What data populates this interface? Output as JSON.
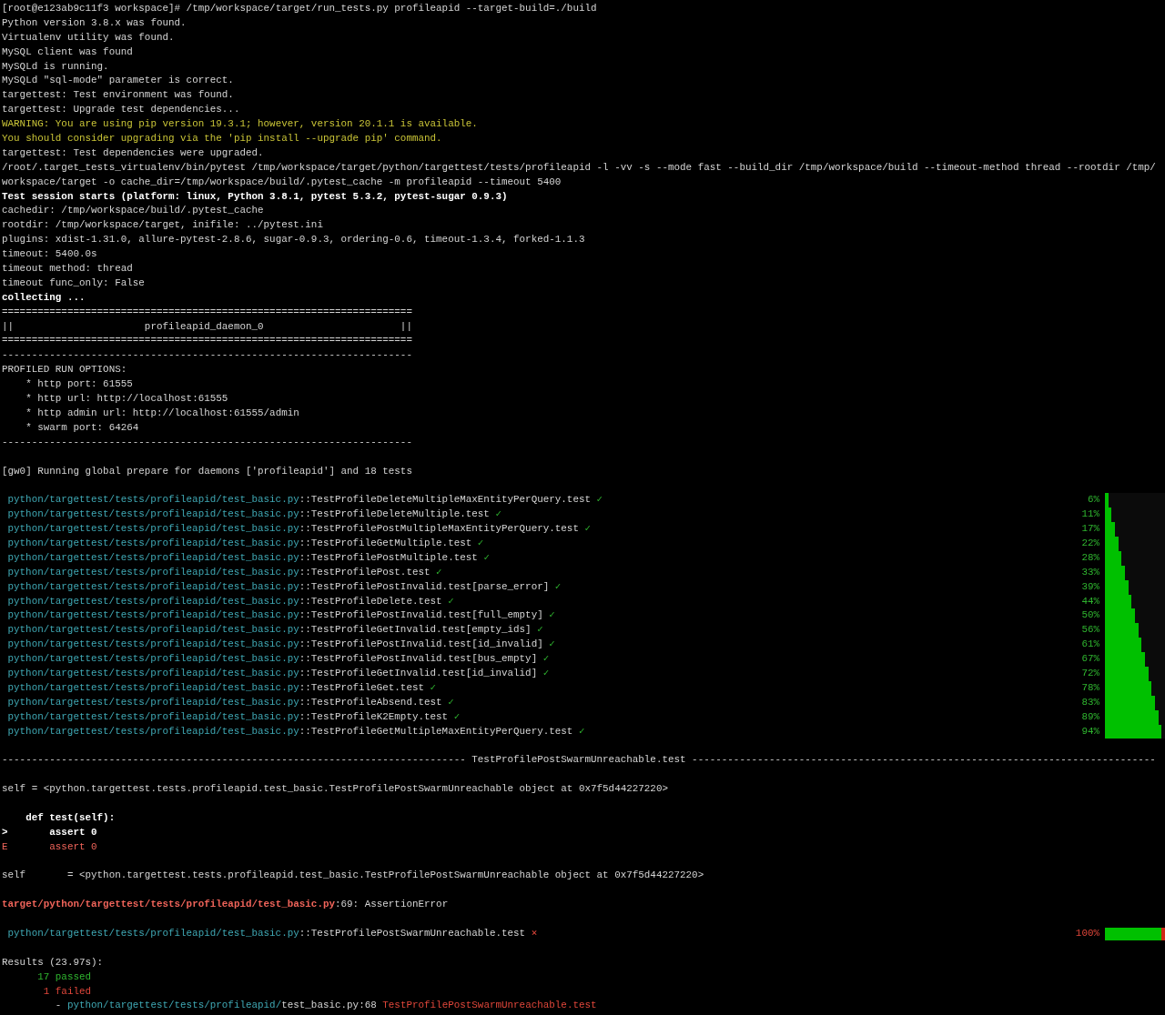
{
  "terminal": {
    "lines": [
      {
        "kind": "line",
        "segments": [
          {
            "text": "[root@e123ab9c11f3 workspace]# /tmp/workspace/target/run_tests.py profileapid --target-build=./build",
            "kind": "plain"
          }
        ]
      },
      {
        "kind": "line",
        "segments": [
          {
            "text": "Python version 3.8.x was found.",
            "kind": "plain"
          }
        ]
      },
      {
        "kind": "line",
        "segments": [
          {
            "text": "Virtualenv utility was found.",
            "kind": "plain"
          }
        ]
      },
      {
        "kind": "line",
        "segments": [
          {
            "text": "MySQL client was found",
            "kind": "plain"
          }
        ]
      },
      {
        "kind": "line",
        "segments": [
          {
            "text": "MySQLd is running.",
            "kind": "plain"
          }
        ]
      },
      {
        "kind": "line",
        "segments": [
          {
            "text": "MySQLd \"sql-mode\" parameter is correct.",
            "kind": "plain"
          }
        ]
      },
      {
        "kind": "line",
        "segments": [
          {
            "text": "targettest: Test environment was found.",
            "kind": "plain"
          }
        ]
      },
      {
        "kind": "line",
        "segments": [
          {
            "text": "targettest: Upgrade test dependencies...",
            "kind": "plain"
          }
        ]
      },
      {
        "kind": "line",
        "segments": [
          {
            "text": "WARNING: You are using pip version 19.3.1; however, version 20.1.1 is available.",
            "kind": "warning"
          }
        ]
      },
      {
        "kind": "line",
        "segments": [
          {
            "text": "You should consider upgrading via the 'pip install --upgrade pip' command.",
            "kind": "warning"
          }
        ]
      },
      {
        "kind": "line",
        "segments": [
          {
            "text": "targettest: Test dependencies were upgraded.",
            "kind": "plain"
          }
        ]
      },
      {
        "kind": "line",
        "segments": [
          {
            "text": "/root/.target_tests_virtualenv/bin/pytest /tmp/workspace/target/python/targettest/tests/profileapid -l -vv -s --mode fast --build_dir /tmp/workspace/build --timeout-method thread --rootdir /tmp/",
            "kind": "plain"
          }
        ]
      },
      {
        "kind": "line",
        "segments": [
          {
            "text": "workspace/target -o cache_dir=/tmp/workspace/build/.pytest_cache -m profileapid --timeout 5400",
            "kind": "plain"
          }
        ]
      },
      {
        "kind": "line",
        "segments": [
          {
            "text": "Test session starts (platform: linux, Python 3.8.1, pytest 5.3.2, pytest-sugar 0.9.3)",
            "kind": "bold"
          }
        ]
      },
      {
        "kind": "line",
        "segments": [
          {
            "text": "cachedir: /tmp/workspace/build/.pytest_cache",
            "kind": "plain"
          }
        ]
      },
      {
        "kind": "line",
        "segments": [
          {
            "text": "rootdir: /tmp/workspace/target, inifile: ../pytest.ini",
            "kind": "plain"
          }
        ]
      },
      {
        "kind": "line",
        "segments": [
          {
            "text": "plugins: xdist-1.31.0, allure-pytest-2.8.6, sugar-0.9.3, ordering-0.6, timeout-1.3.4, forked-1.1.3",
            "kind": "plain"
          }
        ]
      },
      {
        "kind": "line",
        "segments": [
          {
            "text": "timeout: 5400.0s",
            "kind": "plain"
          }
        ]
      },
      {
        "kind": "line",
        "segments": [
          {
            "text": "timeout method: thread",
            "kind": "plain"
          }
        ]
      },
      {
        "kind": "line",
        "segments": [
          {
            "text": "timeout func_only: False",
            "kind": "plain"
          }
        ]
      },
      {
        "kind": "line",
        "segments": [
          {
            "text": "collecting ...",
            "kind": "bold"
          }
        ]
      },
      {
        "kind": "line",
        "segments": [
          {
            "text": "=====================================================================",
            "kind": "plain"
          }
        ]
      },
      {
        "kind": "line",
        "segments": [
          {
            "text": "||                      profileapid_daemon_0                       ||",
            "kind": "plain"
          }
        ]
      },
      {
        "kind": "line",
        "segments": [
          {
            "text": "=====================================================================",
            "kind": "plain"
          }
        ]
      },
      {
        "kind": "line",
        "segments": [
          {
            "text": "---------------------------------------------------------------------",
            "kind": "plain"
          }
        ]
      },
      {
        "kind": "line",
        "segments": [
          {
            "text": "PROFILED RUN OPTIONS:",
            "kind": "plain"
          }
        ]
      },
      {
        "kind": "line",
        "segments": [
          {
            "text": "    * http port: 61555",
            "kind": "plain"
          }
        ]
      },
      {
        "kind": "line",
        "segments": [
          {
            "text": "    * http url: http://localhost:61555",
            "kind": "plain"
          }
        ]
      },
      {
        "kind": "line",
        "segments": [
          {
            "text": "    * http admin url: http://localhost:61555/admin",
            "kind": "plain"
          }
        ]
      },
      {
        "kind": "line",
        "segments": [
          {
            "text": "    * swarm port: 64264",
            "kind": "plain"
          }
        ]
      },
      {
        "kind": "line",
        "segments": [
          {
            "text": "---------------------------------------------------------------------",
            "kind": "plain"
          }
        ]
      },
      {
        "kind": "blank"
      },
      {
        "kind": "line",
        "segments": [
          {
            "text": "[gw0] Running global prepare for daemons ['profileapid'] and 18 tests",
            "kind": "plain"
          }
        ]
      },
      {
        "kind": "blank"
      },
      {
        "kind": "test",
        "path": "python/targettest/tests/profileapid/test_basic.py",
        "name": "::TestProfileDeleteMultipleMaxEntityPerQuery.test",
        "mark": "✓",
        "failed": false,
        "percent": "6%",
        "bar": [
          {
            "level": 0.06,
            "color": "#00c000"
          }
        ]
      },
      {
        "kind": "test",
        "path": "python/targettest/tests/profileapid/test_basic.py",
        "name": "::TestProfileDeleteMultiple.test",
        "mark": "✓",
        "failed": false,
        "percent": "11%",
        "bar": [
          {
            "level": 0.11,
            "color": "#00c000"
          }
        ]
      },
      {
        "kind": "test",
        "path": "python/targettest/tests/profileapid/test_basic.py",
        "name": "::TestProfilePostMultipleMaxEntityPerQuery.test",
        "mark": "✓",
        "failed": false,
        "percent": "17%",
        "bar": [
          {
            "level": 0.17,
            "color": "#00c000"
          }
        ]
      },
      {
        "kind": "test",
        "path": "python/targettest/tests/profileapid/test_basic.py",
        "name": "::TestProfileGetMultiple.test",
        "mark": "✓",
        "failed": false,
        "percent": "22%",
        "bar": [
          {
            "level": 0.22,
            "color": "#00c000"
          }
        ]
      },
      {
        "kind": "test",
        "path": "python/targettest/tests/profileapid/test_basic.py",
        "name": "::TestProfilePostMultiple.test",
        "mark": "✓",
        "failed": false,
        "percent": "28%",
        "bar": [
          {
            "level": 0.28,
            "color": "#00c000"
          }
        ]
      },
      {
        "kind": "test",
        "path": "python/targettest/tests/profileapid/test_basic.py",
        "name": "::TestProfilePost.test",
        "mark": "✓",
        "failed": false,
        "percent": "33%",
        "bar": [
          {
            "level": 0.33,
            "color": "#00c000"
          }
        ]
      },
      {
        "kind": "test",
        "path": "python/targettest/tests/profileapid/test_basic.py",
        "name": "::TestProfilePostInvalid.test[parse_error]",
        "mark": "✓",
        "failed": false,
        "percent": "39%",
        "bar": [
          {
            "level": 0.39,
            "color": "#00c000"
          }
        ]
      },
      {
        "kind": "test",
        "path": "python/targettest/tests/profileapid/test_basic.py",
        "name": "::TestProfileDelete.test",
        "mark": "✓",
        "failed": false,
        "percent": "44%",
        "bar": [
          {
            "level": 0.44,
            "color": "#00c000"
          }
        ]
      },
      {
        "kind": "test",
        "path": "python/targettest/tests/profileapid/test_basic.py",
        "name": "::TestProfilePostInvalid.test[full_empty]",
        "mark": "✓",
        "failed": false,
        "percent": "50%",
        "bar": [
          {
            "level": 0.5,
            "color": "#00c000"
          }
        ]
      },
      {
        "kind": "test",
        "path": "python/targettest/tests/profileapid/test_basic.py",
        "name": "::TestProfileGetInvalid.test[empty_ids]",
        "mark": "✓",
        "failed": false,
        "percent": "56%",
        "bar": [
          {
            "level": 0.56,
            "color": "#00c000"
          }
        ]
      },
      {
        "kind": "test",
        "path": "python/targettest/tests/profileapid/test_basic.py",
        "name": "::TestProfilePostInvalid.test[id_invalid]",
        "mark": "✓",
        "failed": false,
        "percent": "61%",
        "bar": [
          {
            "level": 0.61,
            "color": "#00c000"
          }
        ]
      },
      {
        "kind": "test",
        "path": "python/targettest/tests/profileapid/test_basic.py",
        "name": "::TestProfilePostInvalid.test[bus_empty]",
        "mark": "✓",
        "failed": false,
        "percent": "67%",
        "bar": [
          {
            "level": 0.67,
            "color": "#00c000"
          }
        ]
      },
      {
        "kind": "test",
        "path": "python/targettest/tests/profileapid/test_basic.py",
        "name": "::TestProfileGetInvalid.test[id_invalid]",
        "mark": "✓",
        "failed": false,
        "percent": "72%",
        "bar": [
          {
            "level": 0.72,
            "color": "#00c000"
          }
        ]
      },
      {
        "kind": "test",
        "path": "python/targettest/tests/profileapid/test_basic.py",
        "name": "::TestProfileGet.test",
        "mark": "✓",
        "failed": false,
        "percent": "78%",
        "bar": [
          {
            "level": 0.78,
            "color": "#00c000"
          }
        ]
      },
      {
        "kind": "test",
        "path": "python/targettest/tests/profileapid/test_basic.py",
        "name": "::TestProfileAbsend.test",
        "mark": "✓",
        "failed": false,
        "percent": "83%",
        "bar": [
          {
            "level": 0.83,
            "color": "#00c000"
          }
        ]
      },
      {
        "kind": "test",
        "path": "python/targettest/tests/profileapid/test_basic.py",
        "name": "::TestProfileK2Empty.test",
        "mark": "✓",
        "failed": false,
        "percent": "89%",
        "bar": [
          {
            "level": 0.89,
            "color": "#00c000"
          }
        ]
      },
      {
        "kind": "test",
        "path": "python/targettest/tests/profileapid/test_basic.py",
        "name": "::TestProfileGetMultipleMaxEntityPerQuery.test",
        "mark": "✓",
        "failed": false,
        "percent": "94%",
        "bar": [
          {
            "level": 0.94,
            "color": "#00c000"
          }
        ]
      },
      {
        "kind": "blank"
      },
      {
        "kind": "line",
        "segments": [
          {
            "text": "------------------------------------------------------------------------------ TestProfilePostSwarmUnreachable.test ------------------------------------------------------------------------------",
            "kind": "plain"
          }
        ]
      },
      {
        "kind": "blank"
      },
      {
        "kind": "line",
        "segments": [
          {
            "text": "self = <python.targettest.tests.profileapid.test_basic.TestProfilePostSwarmUnreachable object at 0x7f5d44227220>",
            "kind": "plain"
          }
        ]
      },
      {
        "kind": "blank"
      },
      {
        "kind": "line",
        "segments": [
          {
            "text": "    def test(self):",
            "kind": "bold"
          }
        ]
      },
      {
        "kind": "line",
        "segments": [
          {
            "text": ">       assert 0",
            "kind": "bold"
          }
        ]
      },
      {
        "kind": "line",
        "segments": [
          {
            "text": "E       assert 0",
            "kind": "error"
          }
        ]
      },
      {
        "kind": "blank"
      },
      {
        "kind": "line",
        "segments": [
          {
            "text": "self       = <python.targettest.tests.profileapid.test_basic.TestProfilePostSwarmUnreachable object at 0x7f5d44227220>",
            "kind": "plain"
          }
        ]
      },
      {
        "kind": "blank"
      },
      {
        "kind": "line",
        "segments": [
          {
            "text": "target/python/targettest/tests/profileapid/test_basic.py",
            "kind": "error_path"
          },
          {
            "text": ":69: AssertionError",
            "kind": "plain"
          }
        ]
      },
      {
        "kind": "blank"
      },
      {
        "kind": "test",
        "path": "python/targettest/tests/profileapid/test_basic.py",
        "name": "::TestProfilePostSwarmUnreachable.test",
        "mark": "⨯",
        "failed": true,
        "percent": "100%",
        "bar": [
          {
            "level": 0.94,
            "color": "#00c000"
          },
          {
            "level": 0.06,
            "color": "#d02818"
          }
        ]
      },
      {
        "kind": "blank"
      },
      {
        "kind": "line",
        "segments": [
          {
            "text": "Results (23.97s):",
            "kind": "plain"
          }
        ]
      },
      {
        "kind": "line",
        "segments": [
          {
            "text": "      17 passed",
            "kind": "pass"
          }
        ]
      },
      {
        "kind": "line",
        "segments": [
          {
            "text": "       1 failed",
            "kind": "fail"
          }
        ]
      },
      {
        "kind": "line",
        "segments": [
          {
            "text": "         - ",
            "kind": "plain"
          },
          {
            "text": "python/targettest/tests/profileapid/",
            "kind": "path"
          },
          {
            "text": "test_basic.py:68 ",
            "kind": "plain"
          },
          {
            "text": "TestProfilePostSwarmUnreachable.test",
            "kind": "fail"
          }
        ]
      }
    ]
  }
}
